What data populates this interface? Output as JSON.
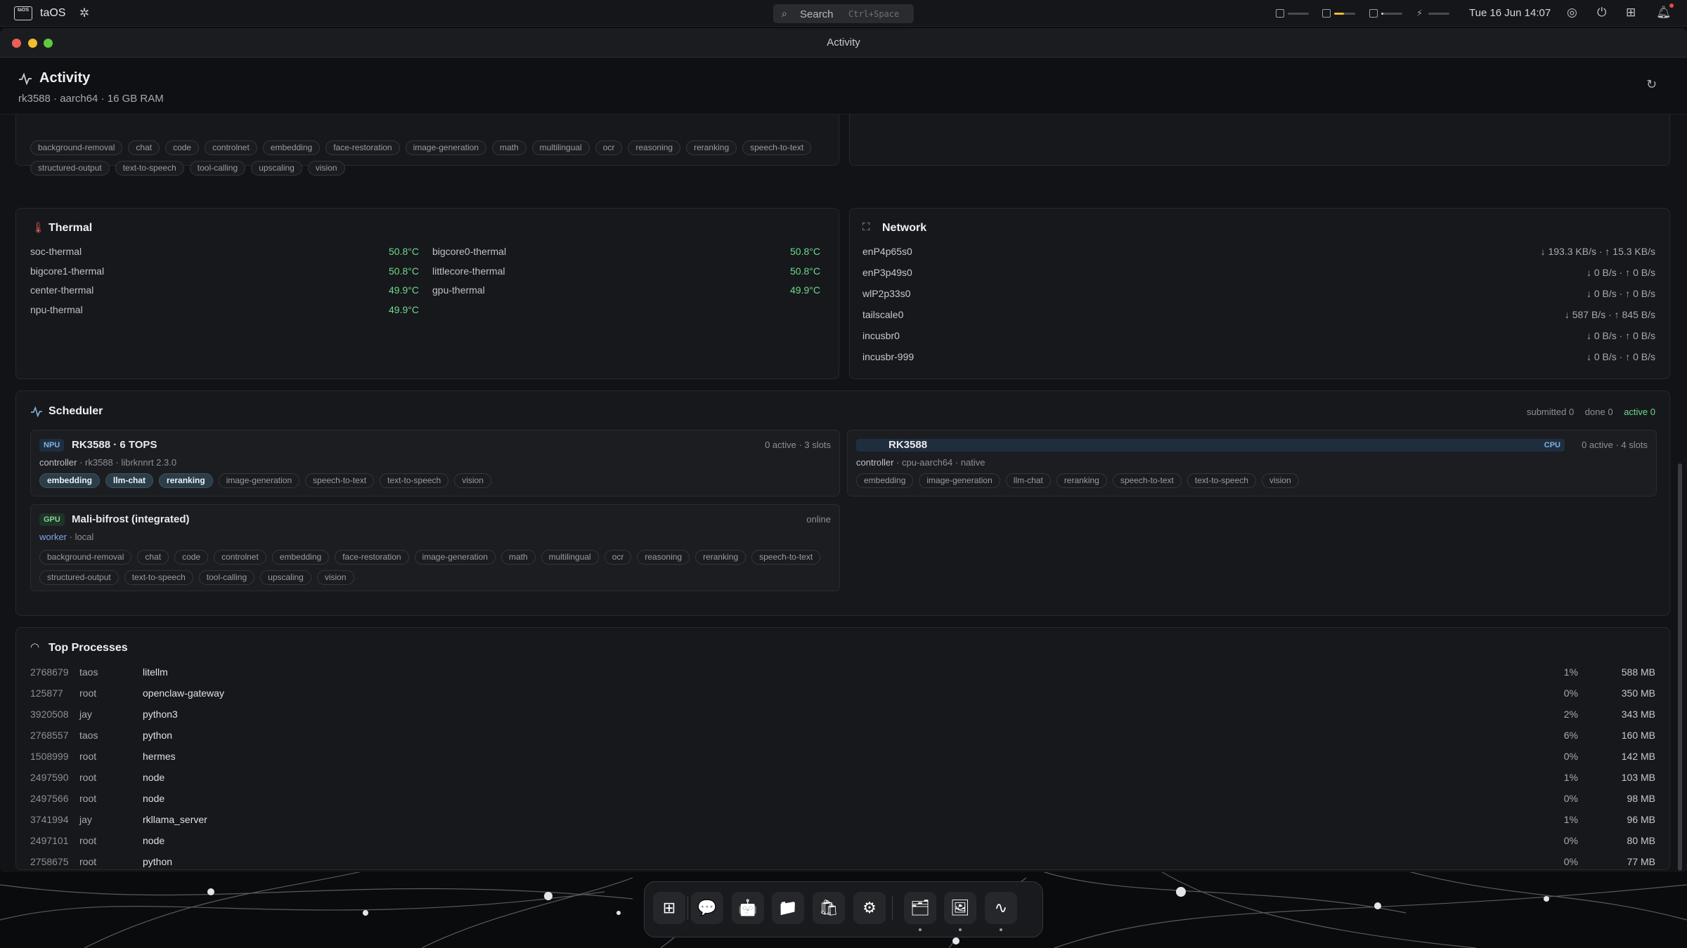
{
  "topbar": {
    "logo_text": "taOS",
    "os_name": "taOS",
    "search_label": "Search",
    "search_shortcut": "Ctrl+Space",
    "meters": [
      {
        "name": "cpu-meter",
        "value": 0.0
      },
      {
        "name": "memory-meter",
        "value": 0.45
      },
      {
        "name": "disk-meter",
        "value": 0.1
      },
      {
        "name": "power-meter",
        "value": 0.0
      }
    ],
    "meter_accent": "#f2bd2e",
    "clock": "Tue 16 Jun 14:07"
  },
  "window": {
    "title": "Activity"
  },
  "app": {
    "title": "Activity",
    "subtitle": "rk3588 · aarch64 · 16 GB RAM"
  },
  "top_card": {
    "chips_row1": [
      "background-removal",
      "chat",
      "code",
      "controlnet",
      "embedding",
      "face-restoration",
      "image-generation",
      "math",
      "multilingual",
      "ocr",
      "reasoning",
      "reranking",
      "speech-to-text"
    ],
    "chips_row2": [
      "structured-output",
      "text-to-speech",
      "tool-calling",
      "upscaling",
      "vision"
    ]
  },
  "thermal": {
    "title": "Thermal",
    "left": [
      {
        "name": "soc-thermal",
        "value": "50.8°C"
      },
      {
        "name": "bigcore1-thermal",
        "value": "50.8°C"
      },
      {
        "name": "center-thermal",
        "value": "49.9°C"
      },
      {
        "name": "npu-thermal",
        "value": "49.9°C"
      }
    ],
    "right": [
      {
        "name": "bigcore0-thermal",
        "value": "50.8°C"
      },
      {
        "name": "littlecore-thermal",
        "value": "50.8°C"
      },
      {
        "name": "gpu-thermal",
        "value": "49.9°C"
      }
    ]
  },
  "network": {
    "title": "Network",
    "interfaces": [
      {
        "name": "enP4p65s0",
        "rate": "↓ 193.3 KB/s · ↑ 15.3 KB/s"
      },
      {
        "name": "enP3p49s0",
        "rate": "↓ 0 B/s · ↑ 0 B/s"
      },
      {
        "name": "wlP2p33s0",
        "rate": "↓ 0 B/s · ↑ 0 B/s"
      },
      {
        "name": "tailscale0",
        "rate": "↓ 587 B/s · ↑ 845 B/s"
      },
      {
        "name": "incusbr0",
        "rate": "↓ 0 B/s · ↑ 0 B/s"
      },
      {
        "name": "incusbr-999",
        "rate": "↓ 0 B/s · ↑ 0 B/s"
      }
    ]
  },
  "scheduler": {
    "title": "Scheduler",
    "submitted": "submitted 0",
    "done": "done 0",
    "active": "active 0",
    "npu": {
      "badge": "NPU",
      "name": "RK3588 · 6 TOPS",
      "status": "0 active · 3 slots",
      "role": "controller",
      "meta": " · rk3588 · librknnrt 2.3.0",
      "chips": [
        {
          "label": "embedding",
          "on": true
        },
        {
          "label": "llm-chat",
          "on": true
        },
        {
          "label": "reranking",
          "on": true
        },
        {
          "label": "image-generation",
          "on": false
        },
        {
          "label": "speech-to-text",
          "on": false
        },
        {
          "label": "text-to-speech",
          "on": false
        },
        {
          "label": "vision",
          "on": false
        }
      ]
    },
    "cpu": {
      "badge": "CPU",
      "name": "RK3588",
      "status": "0 active · 4 slots",
      "role": "controller",
      "meta": " · cpu-aarch64 · native",
      "chips": [
        "embedding",
        "image-generation",
        "llm-chat",
        "reranking",
        "speech-to-text",
        "text-to-speech",
        "vision"
      ]
    },
    "gpu": {
      "badge": "GPU",
      "name": "Mali-bifrost (integrated)",
      "status": "online",
      "role": "worker",
      "meta": " · local",
      "chips_row1": [
        "background-removal",
        "chat",
        "code",
        "controlnet",
        "embedding",
        "face-restoration",
        "image-generation",
        "math",
        "multilingual",
        "ocr",
        "reasoning",
        "reranking",
        "speech-to-text"
      ],
      "chips_row2": [
        "structured-output",
        "text-to-speech",
        "tool-calling",
        "upscaling",
        "vision"
      ]
    }
  },
  "processes": {
    "title": "Top Processes",
    "rows": [
      {
        "pid": "2768679",
        "user": "taos",
        "cmd": "litellm",
        "cpu": "1%",
        "mem": "588 MB"
      },
      {
        "pid": "125877",
        "user": "root",
        "cmd": "openclaw-gateway",
        "cpu": "0%",
        "mem": "350 MB"
      },
      {
        "pid": "3920508",
        "user": "jay",
        "cmd": "python3",
        "cpu": "2%",
        "mem": "343 MB"
      },
      {
        "pid": "2768557",
        "user": "taos",
        "cmd": "python",
        "cpu": "6%",
        "mem": "160 MB"
      },
      {
        "pid": "1508999",
        "user": "root",
        "cmd": "hermes",
        "cpu": "0%",
        "mem": "142 MB"
      },
      {
        "pid": "2497590",
        "user": "root",
        "cmd": "node",
        "cpu": "1%",
        "mem": "103 MB"
      },
      {
        "pid": "2497566",
        "user": "root",
        "cmd": "node",
        "cpu": "0%",
        "mem": "98 MB"
      },
      {
        "pid": "3741994",
        "user": "jay",
        "cmd": "rkllama_server",
        "cpu": "1%",
        "mem": "96 MB"
      },
      {
        "pid": "2497101",
        "user": "root",
        "cmd": "node",
        "cpu": "0%",
        "mem": "80 MB"
      },
      {
        "pid": "2758675",
        "user": "root",
        "cmd": "python",
        "cpu": "0%",
        "mem": "77 MB"
      }
    ]
  },
  "dock": {
    "items": [
      {
        "name": "launcher",
        "icon": "grid-icon",
        "glyph": "⊞",
        "running": false
      },
      {
        "name": "chat",
        "icon": "chat-bubble-icon",
        "glyph": "💬",
        "running": false
      },
      {
        "name": "agents",
        "icon": "robot-icon",
        "glyph": "🤖",
        "running": false
      },
      {
        "name": "files",
        "icon": "folder-icon",
        "glyph": "📁",
        "running": false
      },
      {
        "name": "store",
        "icon": "shopping-bag-icon",
        "glyph": "🛍",
        "running": false
      },
      {
        "name": "settings",
        "icon": "gear-icon",
        "glyph": "⚙",
        "running": false
      },
      {
        "name": "models",
        "icon": "model-folder-icon",
        "glyph": "🗂",
        "running": true
      },
      {
        "name": "images",
        "icon": "image-icon",
        "glyph": "🖼",
        "running": true
      },
      {
        "name": "activity",
        "icon": "pulse-icon",
        "glyph": "∿",
        "running": true
      }
    ]
  }
}
